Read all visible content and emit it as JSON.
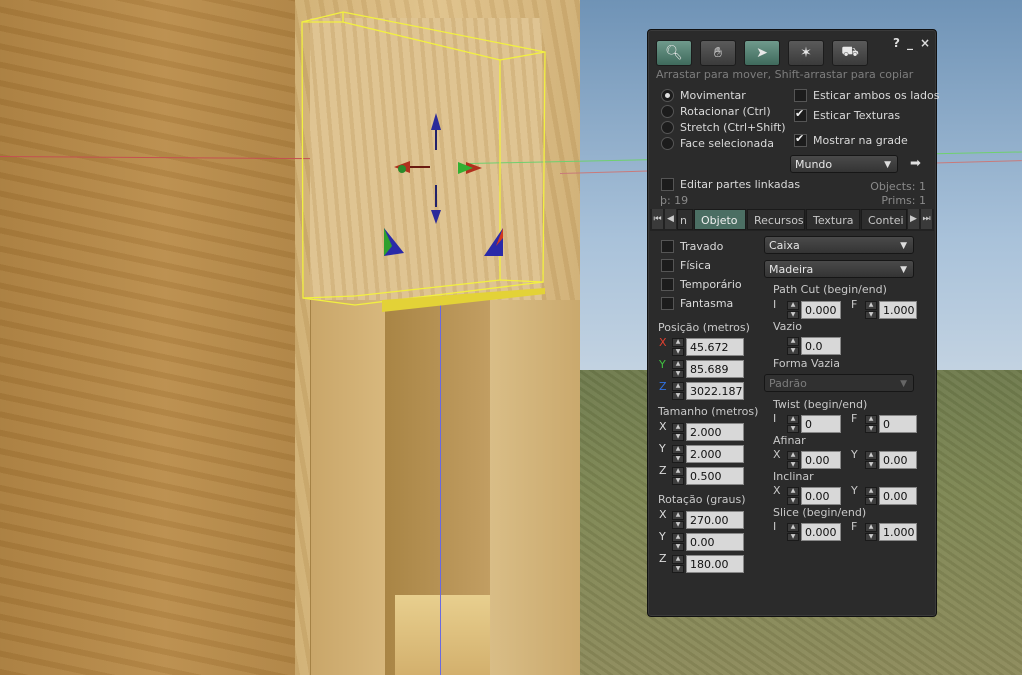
{
  "toolbar": {
    "title_controls": [
      "?",
      "_",
      "×"
    ],
    "tool_icons": [
      "magnifier-icon",
      "hand-icon",
      "arrow-cursor-icon",
      "wand-icon",
      "bulldozer-icon"
    ],
    "hint": "Arrastar para mover, Shift-arrastar para copiar"
  },
  "modes": [
    {
      "label": "Movimentar",
      "checked": true
    },
    {
      "label": "Rotacionar (Ctrl)",
      "checked": false
    },
    {
      "label": "Stretch (Ctrl+Shift)",
      "checked": false
    },
    {
      "label": "Face selecionada",
      "checked": false
    }
  ],
  "right_options": [
    {
      "label": "Esticar ambos os lados",
      "checked": false
    },
    {
      "label": "Esticar Texturas",
      "checked": true
    },
    {
      "label": "Mostrar na grade",
      "checked": true
    }
  ],
  "grid_ruler": {
    "value": "Mundo"
  },
  "edit_linked": {
    "label": "Editar partes linkadas",
    "checked": false
  },
  "counts": {
    "objects": "Objects: 1",
    "prims": "Prims: 1",
    "land_impact": "þ: 19"
  },
  "tabs": [
    "n",
    "Objeto",
    "Recursos",
    "Textura",
    "Contei"
  ],
  "active_tab": "Objeto",
  "flags": [
    {
      "label": "Travado"
    },
    {
      "label": "Física"
    },
    {
      "label": "Temporário"
    },
    {
      "label": "Fantasma"
    }
  ],
  "position": {
    "label": "Posição (metros)",
    "x": "45.672",
    "y": "85.689",
    "z": "3022.187"
  },
  "size": {
    "label": "Tamanho (metros)",
    "x": "2.000",
    "y": "2.000",
    "z": "0.500"
  },
  "rotation": {
    "label": "Rotação (graus)",
    "x": "270.00",
    "y": "0.00",
    "z": "180.00"
  },
  "axis_letters": {
    "x": "X",
    "y": "Y",
    "z": "Z"
  },
  "shape": {
    "building_block": "Caixa",
    "material": "Madeira"
  },
  "path_cut": {
    "label": "Path Cut (begin/end)",
    "b_label": "I",
    "e_label": "F",
    "begin": "0.000",
    "end": "1.000"
  },
  "hollow": {
    "label": "Vazio",
    "value": "0.0"
  },
  "hollow_shape": {
    "label": "Forma Vazia",
    "value": "Padrão"
  },
  "twist": {
    "label": "Twist (begin/end)",
    "b_label": "I",
    "e_label": "F",
    "begin": "0",
    "end": "0"
  },
  "taper": {
    "label": "Afinar",
    "x_label": "X",
    "y_label": "Y",
    "x": "0.00",
    "y": "0.00"
  },
  "shear": {
    "label": "Inclinar",
    "x_label": "X",
    "y_label": "Y",
    "x": "0.00",
    "y": "0.00"
  },
  "slice": {
    "label": "Slice (begin/end)",
    "b_label": "I",
    "e_label": "F",
    "begin": "0.000",
    "end": "1.000"
  },
  "colors": {
    "axis_x": "#e04030",
    "axis_y": "#40c040",
    "axis_z": "#3070e0",
    "active_tab": "#4b6e63",
    "selection": "#f2f040"
  }
}
